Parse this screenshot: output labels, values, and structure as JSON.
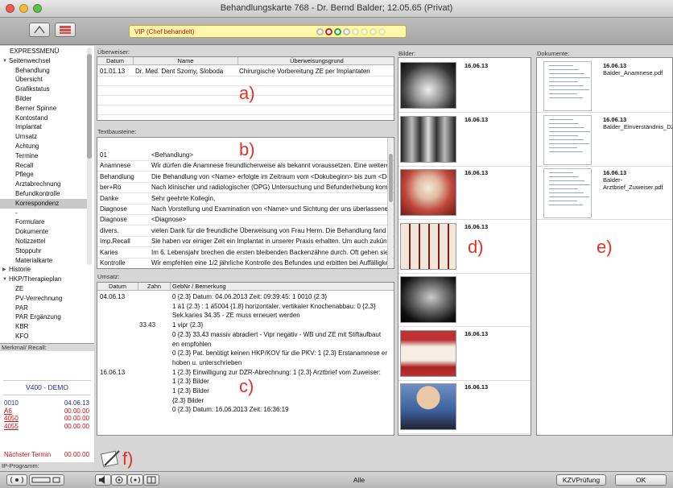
{
  "window": {
    "title": "Behandlungskarte 768 - Dr. Bernd Balder; 12.05.65 (Privat)"
  },
  "colors": {
    "vip_text": "#cc1111",
    "annotation": "#e5302a",
    "demo": "#1e2ea8",
    "red_code": "#cc1111"
  },
  "vip": {
    "text": "VIP (Chef behandelt)"
  },
  "sidebar": {
    "nav": [
      {
        "label": "EXPRESSMENÜ",
        "indent": 1,
        "arrow": ""
      },
      {
        "label": "Seitenwechsel",
        "indent": 0,
        "arrow": "▼"
      },
      {
        "label": "Behandlung",
        "indent": 2,
        "arrow": ""
      },
      {
        "label": "Übersicht",
        "indent": 2,
        "arrow": ""
      },
      {
        "label": "Grafikstatus",
        "indent": 2,
        "arrow": ""
      },
      {
        "label": "Bilder",
        "indent": 2,
        "arrow": ""
      },
      {
        "label": "Berner Spinne",
        "indent": 2,
        "arrow": ""
      },
      {
        "label": "Kontostand",
        "indent": 2,
        "arrow": ""
      },
      {
        "label": "Implantat",
        "indent": 2,
        "arrow": ""
      },
      {
        "label": "Umsatz",
        "indent": 2,
        "arrow": ""
      },
      {
        "label": "Achtung",
        "indent": 2,
        "arrow": ""
      },
      {
        "label": "Termine",
        "indent": 2,
        "arrow": ""
      },
      {
        "label": "Recall",
        "indent": 2,
        "arrow": ""
      },
      {
        "label": "Pflege",
        "indent": 2,
        "arrow": ""
      },
      {
        "label": "Arztabrechnung",
        "indent": 2,
        "arrow": ""
      },
      {
        "label": "Befundkontrolle",
        "indent": 2,
        "arrow": ""
      },
      {
        "label": "Korrespondenz",
        "indent": 2,
        "arrow": "",
        "selected": true
      },
      {
        "label": "-",
        "indent": 2,
        "arrow": ""
      },
      {
        "label": "Formulare",
        "indent": 2,
        "arrow": ""
      },
      {
        "label": "Dokumente",
        "indent": 2,
        "arrow": ""
      },
      {
        "label": "Notizzettel",
        "indent": 2,
        "arrow": ""
      },
      {
        "label": "Stoppuhr",
        "indent": 2,
        "arrow": ""
      },
      {
        "label": "Materialkarte",
        "indent": 2,
        "arrow": ""
      },
      {
        "label": "Historie",
        "indent": 0,
        "arrow": "▶"
      },
      {
        "label": "HKP/Therapieplan",
        "indent": 0,
        "arrow": "▼"
      },
      {
        "label": "ZE",
        "indent": 2,
        "arrow": ""
      },
      {
        "label": "PV-Verrechnung",
        "indent": 2,
        "arrow": ""
      },
      {
        "label": "PAR",
        "indent": 2,
        "arrow": ""
      },
      {
        "label": "PAR Ergänzung",
        "indent": 2,
        "arrow": ""
      },
      {
        "label": "KBR",
        "indent": 2,
        "arrow": ""
      },
      {
        "label": "KFO",
        "indent": 2,
        "arrow": ""
      }
    ],
    "merkmal_title": "Merkmal/ Recall:",
    "demo": "V400 - DEMO",
    "codes": [
      {
        "code": "0010",
        "date": "04.06.13",
        "red": false
      },
      {
        "code": "Ä6",
        "date": "00.00.00",
        "red": true
      },
      {
        "code": "4050",
        "date": "00.00.00",
        "red": true
      },
      {
        "code": "4055",
        "date": "00.00.00",
        "red": true
      }
    ],
    "next_label": "Nächster Termin",
    "next_value": "00.00.00",
    "ip_title": "IP-Programm:"
  },
  "ueberweiser": {
    "title": "Überweiser:",
    "headers": [
      "Datum",
      "Name",
      "Überweisungsgrund"
    ],
    "rows": [
      [
        "01.01.13",
        "Dr. Med. Dent Szomy, Sloboda",
        "Chirurgische Vorbereitung ZE per Implantaten"
      ]
    ],
    "annotation": "a)"
  },
  "textbausteine": {
    "title": "Textbausteine:",
    "annotation": "b)",
    "rows": [
      [
        "01",
        "<Behandlung>"
      ],
      [
        "Anamnese",
        "Wir dürfen die Anamnese freundlicherweise als bekannt voraussetzen. Eine weitere A"
      ],
      [
        "Behandlung",
        "Die Behandlung von <Name> erfolgte im Zeitraum vom <Dokubeginn> bis zum <Dok"
      ],
      [
        "ber+Rö",
        "Nach klinischer und radiologischer (OPG) Untersuchung und Befunderhebung komm"
      ],
      [
        "Danke",
        "Sehr geehrte Kollegin,"
      ],
      [
        "Diagnose",
        "Nach Vorstellung und Examination von <Name> und Sichtung der uns überlassenen"
      ],
      [
        "Diagnose",
        "<Diagnose>"
      ],
      [
        "divers.",
        "vielen Dank für die freundliche Überweisung von Frau Herm. Die Behandlung fand am"
      ],
      [
        "Imp.Recall",
        "Sie haben vor einiger Zeit ein Implantat in unserer Praxis erhalten. Um auch zukünftig"
      ],
      [
        "Karies",
        "Im 6. Lebensjahr brechen die ersten bleibenden Backenzähne durch. Oft gehen sie a"
      ],
      [
        "Kontrolle",
        "Wir empfehlen eine 1/2 jährliche Kontrolle des Befundes und erbitten bei Auffälligkeit"
      ]
    ]
  },
  "umsatz": {
    "title": "Umsatz:",
    "headers": [
      "Datum",
      "Zahn",
      "GebNr / Bemerkung"
    ],
    "annotation": "c)",
    "rows": [
      [
        "04.06.13",
        "",
        "0  {2.3} Datum: 04.06.2013 Zeit: 09:39:45: 1 0010 {2.3}"
      ],
      [
        "",
        "",
        "1 ä1 {2.3} : 1 ä5004 {1.8} horizontaler. vertikaler Knochenabbau: 0  {2.3}"
      ],
      [
        "",
        "",
        "Sek.karies 34.35 - ZE muss erneuert werden"
      ],
      [
        "",
        "33.43",
        "1 vipr {2.3}"
      ],
      [
        "",
        "",
        "0  {2.3} 33.43 massiv abradiert - Vipr negativ - WB und ZE mit Stiftaufbaut"
      ],
      [
        "",
        "",
        "en empfohlen"
      ],
      [
        "",
        "",
        "0  {2.3} Pat. benötigt keinen HKP/KOV für die PKV: 1  {2.3} Erstanamnese er"
      ],
      [
        "",
        "",
        "hoben u. unterschrieben"
      ],
      [
        "16.06.13",
        "",
        "1  {2.3} Einwilligung zur DZR-Abrechnung: 1  {2.3} Arztbrief vom Zuweiser:"
      ],
      [
        "",
        "",
        "1  {2.3} Bilder"
      ],
      [
        "",
        "",
        "1  {2.3} Bilder"
      ],
      [
        "",
        "",
        "{2.3} Bilder"
      ],
      [
        "",
        "",
        "0  {2.3} Datum: 16.06.2013 Zeit: 16:36:19"
      ]
    ]
  },
  "bilder": {
    "title": "Bilder:",
    "annotation": "d)",
    "items": [
      {
        "date": "16.06.13",
        "kind": "xray-pano"
      },
      {
        "date": "16.06.13",
        "kind": "xray-dental"
      },
      {
        "date": "16.06.13",
        "kind": "intraoral"
      },
      {
        "date": "16.06.13",
        "kind": "teeth-model"
      },
      {
        "date": "",
        "kind": "ceph-xray"
      },
      {
        "date": "16.06.13",
        "kind": "smile"
      },
      {
        "date": "16.06.13",
        "kind": "portrait"
      }
    ]
  },
  "dokumente": {
    "title": "Dokumente:",
    "annotation": "e)",
    "items": [
      {
        "date": "16.06.13",
        "name": "Balder_Anamnese.pdf"
      },
      {
        "date": "16.06.13",
        "name": "Balder_Einverständnis_DZR.pdf"
      },
      {
        "date": "16.06.13",
        "name": "Balder-Arztbrief_Zuweiser.pdf"
      }
    ]
  },
  "notes": {
    "annotation": "f)"
  },
  "bottom": {
    "center": "Alle",
    "kzv_label": "KZVPrüfung",
    "ok_label": "OK"
  }
}
